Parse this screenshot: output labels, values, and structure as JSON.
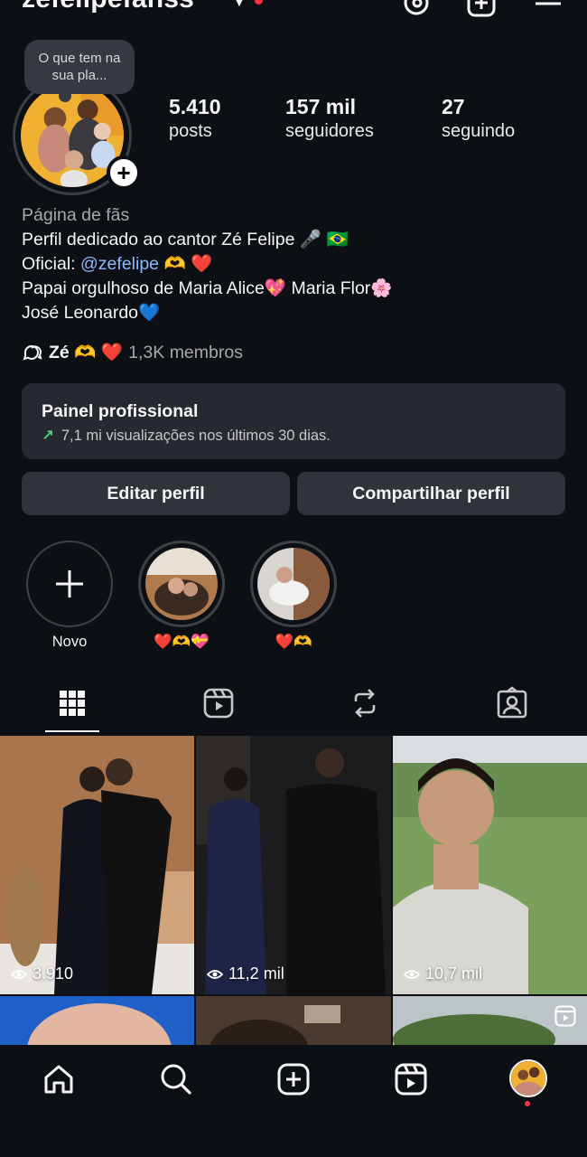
{
  "profile": {
    "username": "zefelipefanss",
    "note": "O que tem na sua pla...",
    "stats": [
      {
        "value": "5.410",
        "label": "posts"
      },
      {
        "value": "157 mil",
        "label": "seguidores"
      },
      {
        "value": "27",
        "label": "seguindo"
      }
    ],
    "category": "Página de fãs",
    "bio_lines": [
      "Perfil dedicado ao cantor Zé Felipe 🎤 🇧🇷",
      "Oficial: ",
      "Papai orgulhoso de Maria Alice💖 Maria Flor🌸",
      "José Leonardo💙"
    ],
    "bio_link": "@zefelipe",
    "bio_link_suffix": " 🫶 ❤️",
    "community_name": "Zé 🫶 ❤️",
    "community_members": "1,3K membros"
  },
  "dashboard": {
    "title": "Painel profissional",
    "arrow": "↗",
    "subtitle": "7,1 mi visualizações nos últimos 30 dias."
  },
  "buttons": {
    "edit": "Editar perfil",
    "share": "Compartilhar perfil"
  },
  "highlights": [
    {
      "label": "Novo"
    },
    {
      "label": "❤️🫶💝"
    },
    {
      "label": "❤️🫶"
    }
  ],
  "grid": {
    "views": [
      "3.910",
      "11,2 mil",
      "10,7 mil"
    ]
  },
  "colors": {
    "background": "#0c1014",
    "card": "#262a30",
    "button": "#2f343a",
    "link": "#8fb9ff",
    "notification": "#ff3040",
    "growth": "#4ed281"
  },
  "icons": {
    "top": [
      "chevron-down-icon",
      "threads-icon",
      "new-post-icon",
      "menu-icon"
    ],
    "tabs": [
      "grid-icon",
      "reels-icon",
      "reposts-icon",
      "tagged-icon"
    ],
    "nav": [
      "home-icon",
      "search-icon",
      "create-icon",
      "reels-icon",
      "profile-avatar"
    ]
  }
}
